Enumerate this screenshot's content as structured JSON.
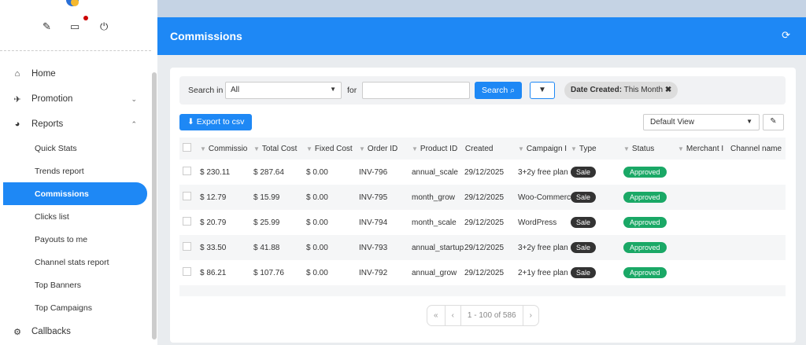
{
  "sidebar": {
    "items": [
      {
        "label": "Home",
        "icon": "home-icon"
      },
      {
        "label": "Promotion",
        "icon": "megaphone-icon"
      },
      {
        "label": "Reports",
        "icon": "chart-icon"
      },
      {
        "label": "Callbacks",
        "icon": "callback-icon"
      }
    ],
    "sub": [
      "Quick Stats",
      "Trends report",
      "Commissions",
      "Clicks list",
      "Payouts to me",
      "Channel stats report",
      "Top Banners",
      "Top Campaigns"
    ]
  },
  "header": {
    "title": "Commissions"
  },
  "filter": {
    "search_in_label": "Search in",
    "search_in_value": "All",
    "for_label": "for",
    "search_value": "",
    "search_button": "Search",
    "chip_key": "Date Created:",
    "chip_value": "This Month"
  },
  "toolbar": {
    "export": "Export to csv",
    "view": "Default View"
  },
  "columns": [
    "Commissio",
    "Total Cost",
    "Fixed Cost",
    "Order ID",
    "Product ID",
    "Created",
    "Campaign I",
    "Type",
    "Status",
    "Merchant I",
    "Channel name"
  ],
  "rows": [
    [
      "$ 230.11",
      "$ 287.64",
      "$ 0.00",
      "INV-796",
      "annual_scale",
      "29/12/2025",
      "3+2y free plan",
      "Sale",
      "Approved"
    ],
    [
      "$ 12.79",
      "$ 15.99",
      "$ 0.00",
      "INV-795",
      "month_grow",
      "29/12/2025",
      "Woo-Commerce",
      "Sale",
      "Approved"
    ],
    [
      "$ 20.79",
      "$ 25.99",
      "$ 0.00",
      "INV-794",
      "month_scale",
      "29/12/2025",
      "WordPress",
      "Sale",
      "Approved"
    ],
    [
      "$ 33.50",
      "$ 41.88",
      "$ 0.00",
      "INV-793",
      "annual_startup",
      "29/12/2025",
      "3+2y free plan",
      "Sale",
      "Approved"
    ],
    [
      "$ 86.21",
      "$ 107.76",
      "$ 0.00",
      "INV-792",
      "annual_grow",
      "29/12/2025",
      "2+1y free plan",
      "Sale",
      "Approved"
    ]
  ],
  "pager": {
    "first": "«",
    "prev": "‹",
    "range": "1 - 100 of 586",
    "next": "›"
  }
}
